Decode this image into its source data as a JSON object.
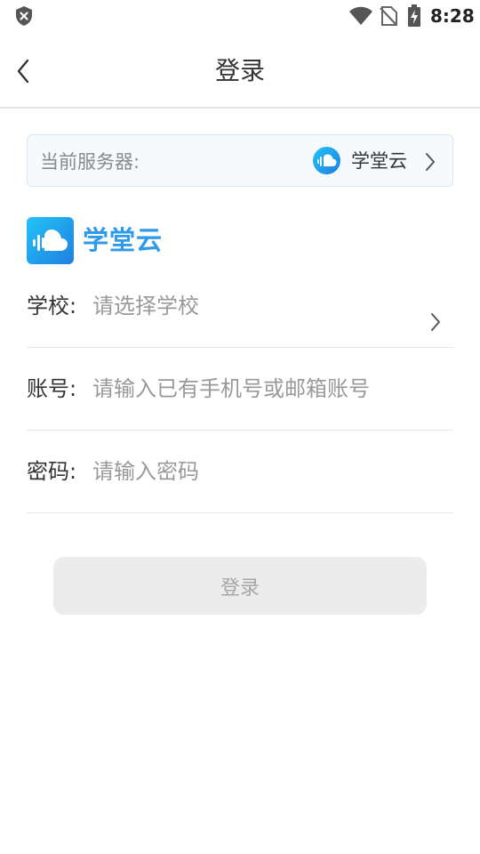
{
  "status_bar": {
    "time": "8:28",
    "icons": [
      "shield-close-icon",
      "wifi-icon",
      "no-sim-icon",
      "battery-charging-icon"
    ]
  },
  "nav": {
    "title": "登录",
    "back_icon": "chevron-left-icon"
  },
  "server": {
    "label": "当前服务器:",
    "name": "学堂云",
    "icon": "cloud-logo-icon"
  },
  "brand": {
    "name": "学堂云",
    "color": "#2e9ae8"
  },
  "form": {
    "school": {
      "label": "学校:",
      "placeholder": "请选择学校"
    },
    "account": {
      "label": "账号:",
      "placeholder": "请输入已有手机号或邮箱账号"
    },
    "password": {
      "label": "密码:",
      "placeholder": "请输入密码"
    }
  },
  "login_button": {
    "label": "登录"
  },
  "colors": {
    "accent": "#2e9ae8",
    "button_disabled_bg": "#ececec",
    "button_disabled_text": "#a6a6a6",
    "placeholder": "#999999"
  }
}
